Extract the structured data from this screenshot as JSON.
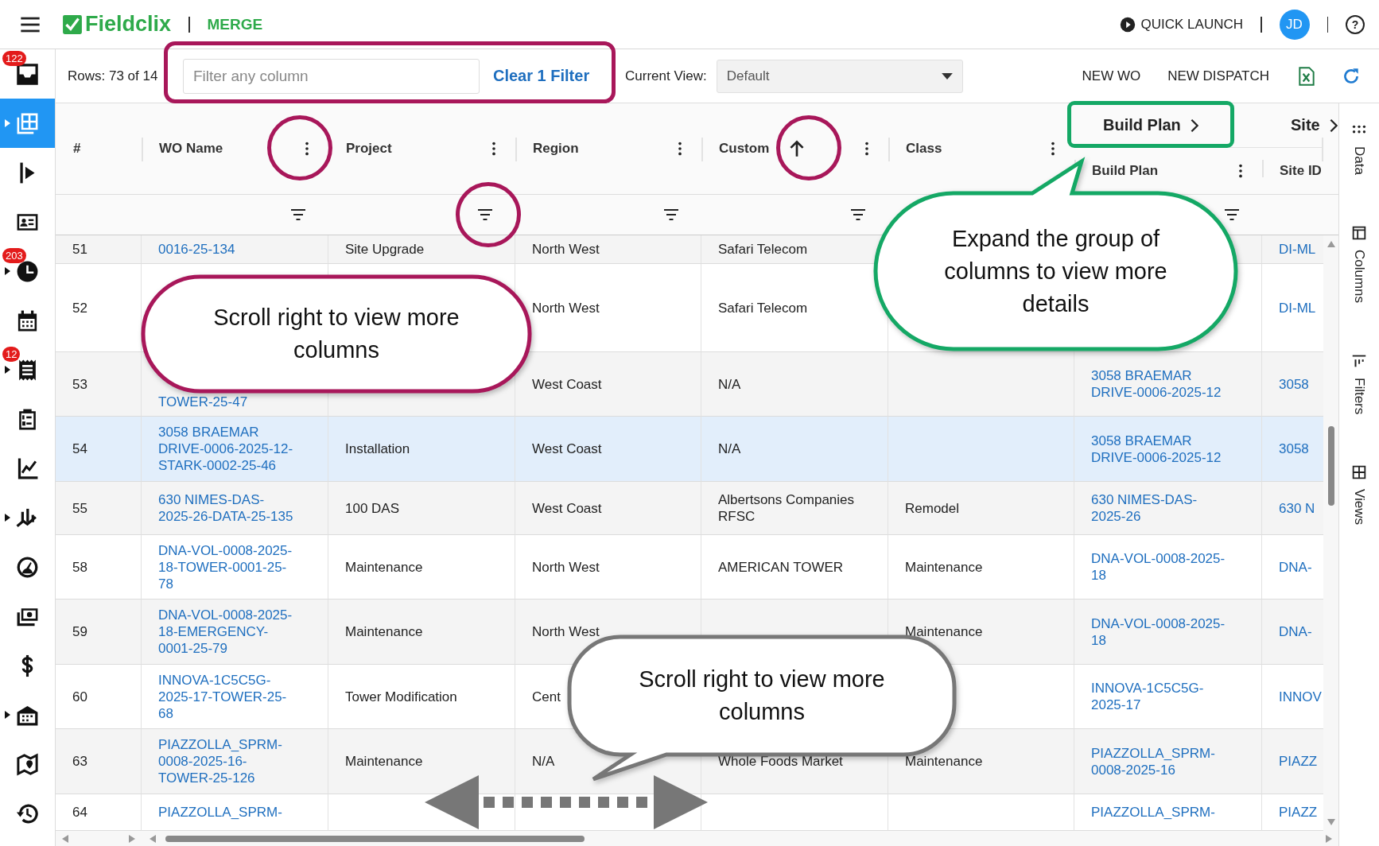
{
  "top_bar": {
    "logo": "Fieldclix",
    "module": "MERGE",
    "quick_launch": "QUICK LAUNCH",
    "avatar": "JD",
    "help": "?"
  },
  "sidebar": {
    "items": [
      {
        "badge": "122",
        "expandable": false,
        "selected": false
      },
      {
        "expandable": true,
        "selected": true
      },
      {
        "expandable": false,
        "selected": false
      },
      {
        "expandable": false,
        "selected": false
      },
      {
        "badge": "203",
        "expandable": true,
        "selected": false
      },
      {
        "expandable": false,
        "selected": false
      },
      {
        "badge": "12",
        "expandable": true,
        "selected": false
      },
      {
        "expandable": false,
        "selected": false
      },
      {
        "expandable": false,
        "selected": false
      },
      {
        "expandable": true,
        "selected": false
      },
      {
        "expandable": false,
        "selected": false
      },
      {
        "expandable": false,
        "selected": false
      },
      {
        "expandable": false,
        "selected": false
      },
      {
        "expandable": true,
        "selected": false
      },
      {
        "expandable": false,
        "selected": false
      },
      {
        "expandable": false,
        "selected": false
      }
    ]
  },
  "toolbar": {
    "rows_label": "Rows: 73 of 14",
    "filter": {
      "placeholder": "Filter any column"
    },
    "clear_filter": "Clear 1 Filter",
    "view_label": "Current View:",
    "view_value": "Default",
    "actions": [
      "NEW WO",
      "NEW DISPATCH"
    ]
  },
  "table": {
    "columns": [
      {
        "label": "#",
        "kind": "number",
        "menu": false,
        "filter": false,
        "sorted": false
      },
      {
        "label": "WO Name",
        "kind": "link",
        "menu": true,
        "filter": true,
        "sorted": false
      },
      {
        "label": "Project",
        "kind": "text",
        "menu": true,
        "filter": true,
        "sorted": false
      },
      {
        "label": "Region",
        "kind": "text",
        "menu": true,
        "filter": true,
        "sorted": false
      },
      {
        "label": "Custom",
        "kind": "text",
        "menu": true,
        "filter": true,
        "sorted": true
      },
      {
        "label": "Class",
        "kind": "text",
        "menu": true,
        "filter": false,
        "sorted": false
      },
      {
        "label": "Build Plan",
        "kind": "link",
        "menu": true,
        "filter": true,
        "sorted": false,
        "group": "Build Plan"
      },
      {
        "label": "Site ID",
        "kind": "link",
        "menu": false,
        "filter": false,
        "sorted": false,
        "group": "Site"
      }
    ],
    "rows": [
      {
        "selected": false,
        "num": "51",
        "wo_name": "0016-25-134",
        "project": "Site Upgrade",
        "region": "North West",
        "customer": "Safari Telecom",
        "site_id": "DI-ML"
      },
      {
        "selected": false,
        "num": "52",
        "region": "North West",
        "customer": "Safari Telecom",
        "site_id": "DI-ML"
      },
      {
        "selected": false,
        "num": "53",
        "wo_name": "TOWER-25-47",
        "region": "West Coast",
        "customer": "N/A",
        "build_plan": "3058 BRAEMAR DRIVE-0006-2025-12",
        "site_id": "3058"
      },
      {
        "selected": true,
        "num": "54",
        "wo_name": "3058 BRAEMAR DRIVE-0006-2025-12-STARK-0002-25-46",
        "project": "Installation",
        "region": "West Coast",
        "customer": "N/A",
        "build_plan": "3058 BRAEMAR DRIVE-0006-2025-12",
        "site_id": "3058"
      },
      {
        "selected": false,
        "num": "55",
        "wo_name": "630 NIMES-DAS-2025-26-DATA-25-135",
        "project": "100 DAS",
        "region": "West Coast",
        "customer": "Albertsons Companies RFSC",
        "class": "Remodel",
        "build_plan": "630 NIMES-DAS-2025-26",
        "site_id": "630 N"
      },
      {
        "selected": false,
        "num": "58",
        "wo_name": "DNA-VOL-0008-2025-18-TOWER-0001-25-78",
        "project": "Maintenance",
        "region": "North West",
        "customer": "AMERICAN TOWER",
        "class": "Maintenance",
        "build_plan": "DNA-VOL-0008-2025-18",
        "site_id": "DNA-"
      },
      {
        "selected": false,
        "num": "59",
        "wo_name": "DNA-VOL-0008-2025-18-EMERGENCY-0001-25-79",
        "project": "Maintenance",
        "region": "North West",
        "class": "Maintenance",
        "build_plan": "DNA-VOL-0008-2025-18",
        "site_id": "DNA-"
      },
      {
        "selected": false,
        "num": "60",
        "wo_name": "INNOVA-1C5C5G-2025-17-TOWER-25-68",
        "project": "Tower Modification",
        "region": "Cent",
        "build_plan": "INNOVA-1C5C5G-2025-17",
        "site_id": "INNOV"
      },
      {
        "selected": false,
        "num": "63",
        "wo_name": "PIAZZOLLA_SPRM-0008-2025-16-TOWER-25-126",
        "project": "Maintenance",
        "region": "N/A",
        "customer": "Whole Foods Market",
        "class": "Maintenance",
        "build_plan": "PIAZZOLLA_SPRM-0008-2025-16",
        "site_id": "PIAZZ"
      },
      {
        "selected": false,
        "num": "64",
        "wo_name": "PIAZZOLLA_SPRM-",
        "build_plan": "PIAZZOLLA_SPRM-",
        "site_id": "PIAZZ"
      }
    ]
  },
  "side_panel": {
    "tabs": [
      {
        "label": "Data"
      },
      {
        "label": "Columns"
      },
      {
        "label": "Filters"
      },
      {
        "label": "Views"
      }
    ]
  },
  "annotations": [
    {
      "kind": "frame",
      "color": "#a8175a"
    },
    {
      "kind": "ring",
      "color": "#a8175a"
    },
    {
      "kind": "ring",
      "color": "#a8175a"
    },
    {
      "kind": "ring",
      "color": "#a8175a"
    },
    {
      "kind": "frame",
      "color": "#14a865"
    },
    {
      "kind": "callout",
      "color": "#a8175a",
      "text": "Scroll right to view more columns"
    },
    {
      "kind": "callout",
      "color": "#14a865",
      "text": "Expand the group of columns to view more details"
    },
    {
      "kind": "callout",
      "color": "#777777",
      "text": "Scroll right to view more columns"
    },
    {
      "kind": "double_arrow",
      "color": "#777777"
    }
  ]
}
